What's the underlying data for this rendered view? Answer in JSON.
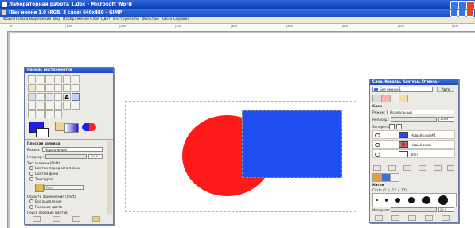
{
  "word_window": {
    "title": "Лабораторная работа 1.doc - Microsoft Word"
  },
  "gimp_window": {
    "title": "[Без имени 1.0 (RGB, 3 слоя) 640x480 – GIMP",
    "menu": [
      "Файл",
      "Правка",
      "Выделение",
      "Вид",
      "Изображение",
      "Слой",
      "Цвет",
      "Инструменты",
      "Фильтры",
      "Окна",
      "Справка"
    ]
  },
  "ruler": {
    "labels": [
      "|0",
      "|100",
      "|200",
      "|300",
      "|400",
      "|500",
      "|600",
      "|700",
      "|800"
    ]
  },
  "toolbox": {
    "title": "Панель инструментов",
    "tool_options_title": "Плоская заливка",
    "mode_label": "Режим:",
    "mode_value": "Нормальный",
    "opacity_label": "Непрозр.:",
    "opacity_value": "100,0",
    "fill_type_label": "Тип заливки (Shift)",
    "fill_options": [
      "Цветом переднего плана",
      "Цветом фона",
      "Текстурой"
    ],
    "pattern_name": "Pine",
    "affected_area_label": "Область применения (Shift)",
    "area_options": [
      "Все выделение",
      "Похожие цвета"
    ],
    "similar_colors_label": "Поиск похожих цветов"
  },
  "layers": {
    "title": "Слои, Каналы, Контуры, Отмена -",
    "image_selector": "Без имени-1",
    "auto_button": "Авто",
    "tab_title": "Слои",
    "mode_label": "Режим:",
    "mode_value": "Нормальный",
    "opacity_label": "Непрозр.:",
    "opacity_value": "100,0",
    "lock_label": "Запереть:",
    "items": [
      {
        "name": "Новый слой#1"
      },
      {
        "name": "Новый слой"
      },
      {
        "name": "Фон"
      }
    ],
    "brushes_title": "Кисти",
    "brush_name": "Circle (11) (17 × 17)",
    "spacing_label": "Интервал:",
    "spacing_value": "20,0"
  },
  "colors": {
    "titlebar": "#1d4ab8",
    "circle": "#ff1a1a",
    "square": "#1f4ff0",
    "fg_color": "#1f1fe0",
    "bg_color": "#ffffff"
  }
}
